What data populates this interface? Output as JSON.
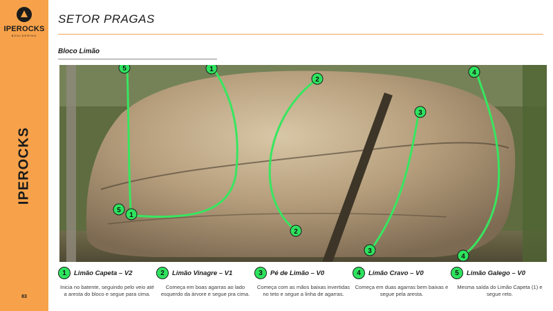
{
  "sidebar": {
    "logo_text": "IPEROCKS",
    "logo_sub": "BOULDERING",
    "vertical_brand": "IPEROCKS",
    "page_number": "83"
  },
  "header": {
    "title": "SETOR PRAGAS",
    "subtitle": "Bloco Limão"
  },
  "colors": {
    "accent": "#f7a24a",
    "route_line": "#37e65f",
    "badge_fill": "#2ee35e"
  },
  "photo": {
    "markers": [
      {
        "id": "start-1",
        "label": "1"
      },
      {
        "id": "end-1",
        "label": "1"
      },
      {
        "id": "start-2",
        "label": "2"
      },
      {
        "id": "end-2",
        "label": "2"
      },
      {
        "id": "start-3",
        "label": "3"
      },
      {
        "id": "end-3",
        "label": "3"
      },
      {
        "id": "start-4",
        "label": "4"
      },
      {
        "id": "end-4",
        "label": "4"
      },
      {
        "id": "start-5",
        "label": "5"
      },
      {
        "id": "end-5",
        "label": "5"
      }
    ]
  },
  "routes": [
    {
      "number": "1",
      "name": "Limão Capeta – V2",
      "description": "Inicia no batente, seguindo pelo veio até a aresta do bloco e segue para cima."
    },
    {
      "number": "2",
      "name": "Limão Vinagre – V1",
      "description": "Começa em boas agarras ao lado esquerdo da árvore e segue pra cima."
    },
    {
      "number": "3",
      "name": "Pé de Limão – V0",
      "description": "Começa com as mãos baixas invertidas no teto e segue a linha de agarras."
    },
    {
      "number": "4",
      "name": "Limão Cravo – V0",
      "description": "Começa em duas agarras bem baixas e segue pela aresta."
    },
    {
      "number": "5",
      "name": "Limão Galego – V0",
      "description": "Mesma saída do Limão Capeta (1) e segue reto."
    }
  ]
}
